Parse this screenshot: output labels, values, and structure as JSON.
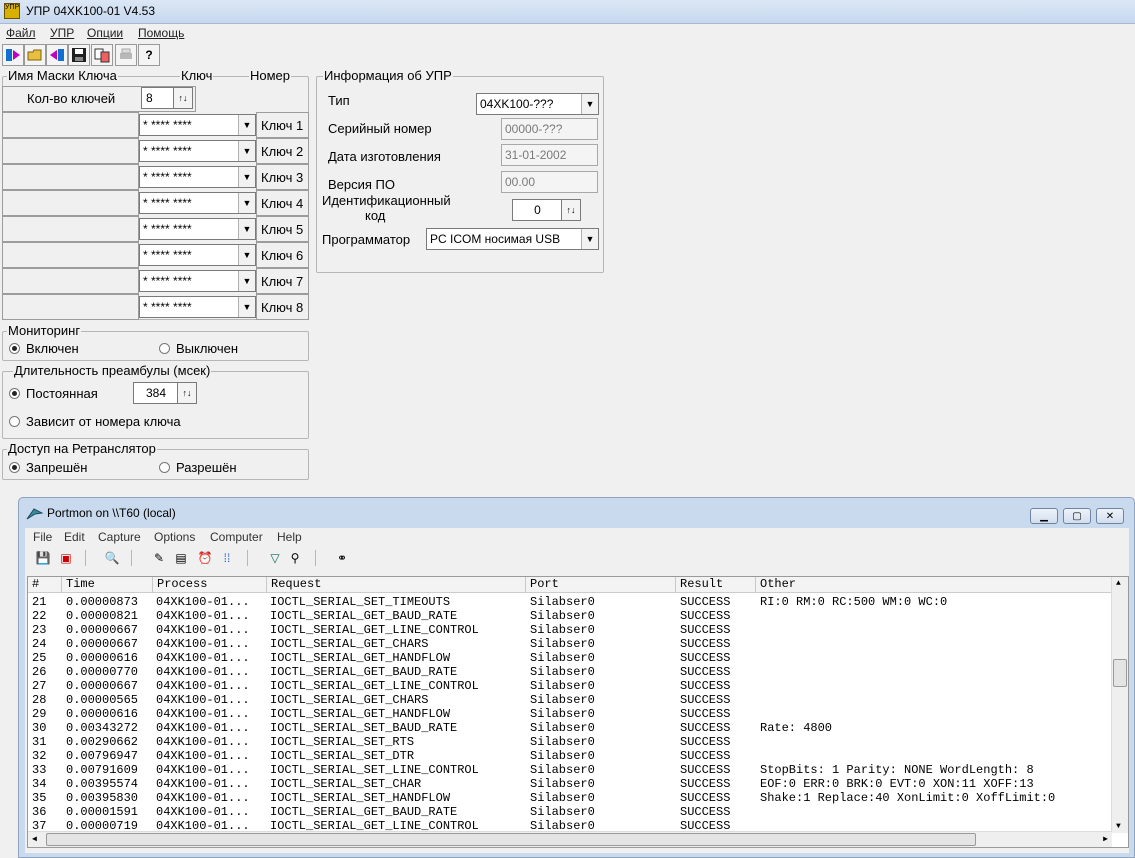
{
  "window": {
    "title": "УПР 04XK100-01    V4.53",
    "icon_text": "УПР"
  },
  "menu": [
    "Файл",
    "УПР",
    "Опции",
    "Помощь"
  ],
  "toolbar_icons": [
    "read-icon",
    "open-icon",
    "write-icon",
    "save-icon",
    "compare-icon",
    "print-icon",
    "help-icon"
  ],
  "keys": {
    "header_mask": "Имя Маски Ключа",
    "header_key": "Ключ",
    "header_num": "Номер",
    "count_label": "Кол-во ключей",
    "count_value": "8",
    "mask_value": "* **** ****",
    "items": [
      "Ключ 1",
      "Ключ 2",
      "Ключ 3",
      "Ключ 4",
      "Ключ 5",
      "Ключ 6",
      "Ключ 7",
      "Ключ 8"
    ]
  },
  "info": {
    "title": "Информация об УПР",
    "type_label": "Тип",
    "type_value": "04XK100-???",
    "serial_label": "Серийный номер",
    "serial_value": "00000-???",
    "date_label": "Дата изготовления",
    "date_value": "31-01-2002",
    "version_label": "Версия ПО",
    "version_value": "00.00",
    "id_label_1": "Идентификационный",
    "id_label_2": "код",
    "id_value": "0",
    "prog_label": "Программатор",
    "prog_value": "PC ICOM носимая USB"
  },
  "monitoring": {
    "title": "Мониторинг",
    "on": "Включен",
    "off": "Выключен"
  },
  "preamble": {
    "title": "Длительность преамбулы (мсек)",
    "const": "Постоянная",
    "const_value": "384",
    "depends": "Зависит от номера ключа"
  },
  "repeater": {
    "title": "Доступ на Ретранслятор",
    "deny": "Запрешён",
    "allow": "Разрешён"
  },
  "portmon": {
    "title": "Portmon on \\\\T60 (local)",
    "menu": [
      "File",
      "Edit",
      "Capture",
      "Options",
      "Computer",
      "Help"
    ],
    "columns": [
      "#",
      "Time",
      "Process",
      "Request",
      "Port",
      "Result",
      "Other"
    ],
    "rows": [
      [
        "21",
        "0.00000873",
        "04XK100-01...",
        "IOCTL_SERIAL_SET_TIMEOUTS",
        "Silabser0",
        "SUCCESS",
        "RI:0 RM:0 RC:500 WM:0 WC:0"
      ],
      [
        "22",
        "0.00000821",
        "04XK100-01...",
        "IOCTL_SERIAL_GET_BAUD_RATE",
        "Silabser0",
        "SUCCESS",
        ""
      ],
      [
        "23",
        "0.00000667",
        "04XK100-01...",
        "IOCTL_SERIAL_GET_LINE_CONTROL",
        "Silabser0",
        "SUCCESS",
        ""
      ],
      [
        "24",
        "0.00000667",
        "04XK100-01...",
        "IOCTL_SERIAL_GET_CHARS",
        "Silabser0",
        "SUCCESS",
        ""
      ],
      [
        "25",
        "0.00000616",
        "04XK100-01...",
        "IOCTL_SERIAL_GET_HANDFLOW",
        "Silabser0",
        "SUCCESS",
        ""
      ],
      [
        "26",
        "0.00000770",
        "04XK100-01...",
        "IOCTL_SERIAL_GET_BAUD_RATE",
        "Silabser0",
        "SUCCESS",
        ""
      ],
      [
        "27",
        "0.00000667",
        "04XK100-01...",
        "IOCTL_SERIAL_GET_LINE_CONTROL",
        "Silabser0",
        "SUCCESS",
        ""
      ],
      [
        "28",
        "0.00000565",
        "04XK100-01...",
        "IOCTL_SERIAL_GET_CHARS",
        "Silabser0",
        "SUCCESS",
        ""
      ],
      [
        "29",
        "0.00000616",
        "04XK100-01...",
        "IOCTL_SERIAL_GET_HANDFLOW",
        "Silabser0",
        "SUCCESS",
        ""
      ],
      [
        "30",
        "0.00343272",
        "04XK100-01...",
        "IOCTL_SERIAL_SET_BAUD_RATE",
        "Silabser0",
        "SUCCESS",
        "Rate: 4800"
      ],
      [
        "31",
        "0.00290662",
        "04XK100-01...",
        "IOCTL_SERIAL_SET_RTS",
        "Silabser0",
        "SUCCESS",
        ""
      ],
      [
        "32",
        "0.00796947",
        "04XK100-01...",
        "IOCTL_SERIAL_SET_DTR",
        "Silabser0",
        "SUCCESS",
        ""
      ],
      [
        "33",
        "0.00791609",
        "04XK100-01...",
        "IOCTL_SERIAL_SET_LINE_CONTROL",
        "Silabser0",
        "SUCCESS",
        "StopBits: 1 Parity: NONE WordLength: 8"
      ],
      [
        "34",
        "0.00395574",
        "04XK100-01...",
        "IOCTL_SERIAL_SET_CHAR",
        "Silabser0",
        "SUCCESS",
        "EOF:0 ERR:0 BRK:0 EVT:0 XON:11 XOFF:13"
      ],
      [
        "35",
        "0.00395830",
        "04XK100-01...",
        "IOCTL_SERIAL_SET_HANDFLOW",
        "Silabser0",
        "SUCCESS",
        "Shake:1 Replace:40 XonLimit:0 XoffLimit:0"
      ],
      [
        "36",
        "0.00001591",
        "04XK100-01...",
        "IOCTL_SERIAL_GET_BAUD_RATE",
        "Silabser0",
        "SUCCESS",
        ""
      ],
      [
        "37",
        "0.00000719",
        "04XK100-01...",
        "IOCTL_SERIAL_GET_LINE_CONTROL",
        "Silabser0",
        "SUCCESS",
        ""
      ]
    ]
  }
}
